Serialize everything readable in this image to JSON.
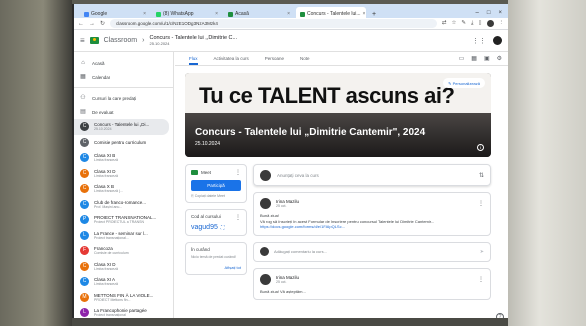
{
  "browser": {
    "tabs": [
      {
        "label": "Google",
        "color": "#4285f4",
        "active": false
      },
      {
        "label": "(8) WhatsApp",
        "color": "#25d366",
        "active": false
      },
      {
        "label": "Acasă",
        "color": "#1e8e3e",
        "active": false
      },
      {
        "label": "Concurs - Talentele lui...",
        "color": "#1e8e3e",
        "active": true
      }
    ],
    "url": "classroom.google.com/u/1/c/NzE1ODg3NzA3Mzk4",
    "window_controls": [
      "–",
      "□",
      "×"
    ]
  },
  "header": {
    "brand": "Classroom",
    "class_title": "Concurs - Talentele lui ,,Dimitrie C...",
    "class_date": "25.10.2024"
  },
  "sidebar": {
    "nav": [
      {
        "icon": "home-icon",
        "glyph": "⌂",
        "label": "Acasă"
      },
      {
        "icon": "calendar-icon",
        "glyph": "▦",
        "label": "Calendar"
      }
    ],
    "teaching": [
      {
        "icon": "people-icon",
        "glyph": "⚇",
        "label": "Cursuri la care predați"
      },
      {
        "icon": "review-icon",
        "glyph": "▤",
        "label": "De evaluat"
      }
    ],
    "classes": [
      {
        "initial": "C",
        "color": "#3c4043",
        "name": "Concurs - Talentele lui „Di...",
        "sub": "25.10.2024",
        "selected": true
      },
      {
        "initial": "C",
        "color": "#5f6368",
        "name": "Comisie pentru curriculum",
        "sub": "",
        "selected": false
      },
      {
        "initial": "C",
        "color": "#1e88e5",
        "name": "Clasa XI B",
        "sub": "Limba franceză",
        "selected": false
      },
      {
        "initial": "C",
        "color": "#e8710a",
        "name": "Clasa XI D",
        "sub": "Limba franceză",
        "selected": false
      },
      {
        "initial": "C",
        "color": "#e8710a",
        "name": "Clasa X B",
        "sub": "Limba franceză (...",
        "selected": false
      },
      {
        "initial": "C",
        "color": "#1e88e5",
        "name": "Club de franco-romance...",
        "sub": "Prof. Mașini anu...",
        "selected": false
      },
      {
        "initial": "P",
        "color": "#1e88e5",
        "name": "PROIECT TRANSNATIONAL...",
        "sub": "Proiect PROIECTUL a TRANSN",
        "selected": false
      },
      {
        "initial": "L",
        "color": "#1e88e5",
        "name": "La France - seminar sur l...",
        "sub": "Proiect transnațional...",
        "selected": false
      },
      {
        "initial": "F",
        "color": "#e53935",
        "name": "Francoza",
        "sub": "Comisie de curriculum",
        "selected": false
      },
      {
        "initial": "C",
        "color": "#e8710a",
        "name": "Clasa XI D",
        "sub": "Limba franceză",
        "selected": false
      },
      {
        "initial": "C",
        "color": "#1e88e5",
        "name": "Clasa XI A",
        "sub": "Limba franceză",
        "selected": false
      },
      {
        "initial": "M",
        "color": "#e8710a",
        "name": "METTONS FIN À LA VIOLE...",
        "sub": "PROIECT Mettons fin...",
        "selected": false
      },
      {
        "initial": "L",
        "color": "#8e24aa",
        "name": "La Francophonie partagée",
        "sub": "Proiect transnațional",
        "selected": false
      }
    ]
  },
  "class_tabs": [
    "Flux",
    "Activitatea la curs",
    "Persoane",
    "Note"
  ],
  "banner": {
    "slogan": "Tu ce TALENT ascuns ai?",
    "title": "Concurs - Talentele lui „Dimitrie Cantemir\", 2024",
    "date": "25.10.2024",
    "personalize": "Personalizează"
  },
  "meet": {
    "label": "Meet",
    "join": "Participă",
    "link_text": "Copiați datele Meet"
  },
  "class_code": {
    "label": "Cod al cursului",
    "value": "vagud95"
  },
  "upcoming": {
    "label": "În curând",
    "text": "Nicio temă de predat curând!",
    "view_all": "Afișați tot"
  },
  "stream": {
    "post_hint": "Anunțați ceva la curs",
    "announcements": [
      {
        "author": "Irina Mazilu",
        "date": "25 oct.",
        "body": "Bună ziua!",
        "body2": "Vă rog să înscrieți în acest Formular de înscriere pentru concursul Talentele lui Dimitrie Cantemir...",
        "link": "https://docs.google.com/forms/d/e/1FAIpQLSc..."
      },
      {
        "author": "Irina Mazilu",
        "date": "25 oct.",
        "body": "Bună ziua! Vă așteptăm...",
        "body2": "",
        "link": ""
      }
    ],
    "comment_hint": "Adăugați comentariu la curs..."
  }
}
